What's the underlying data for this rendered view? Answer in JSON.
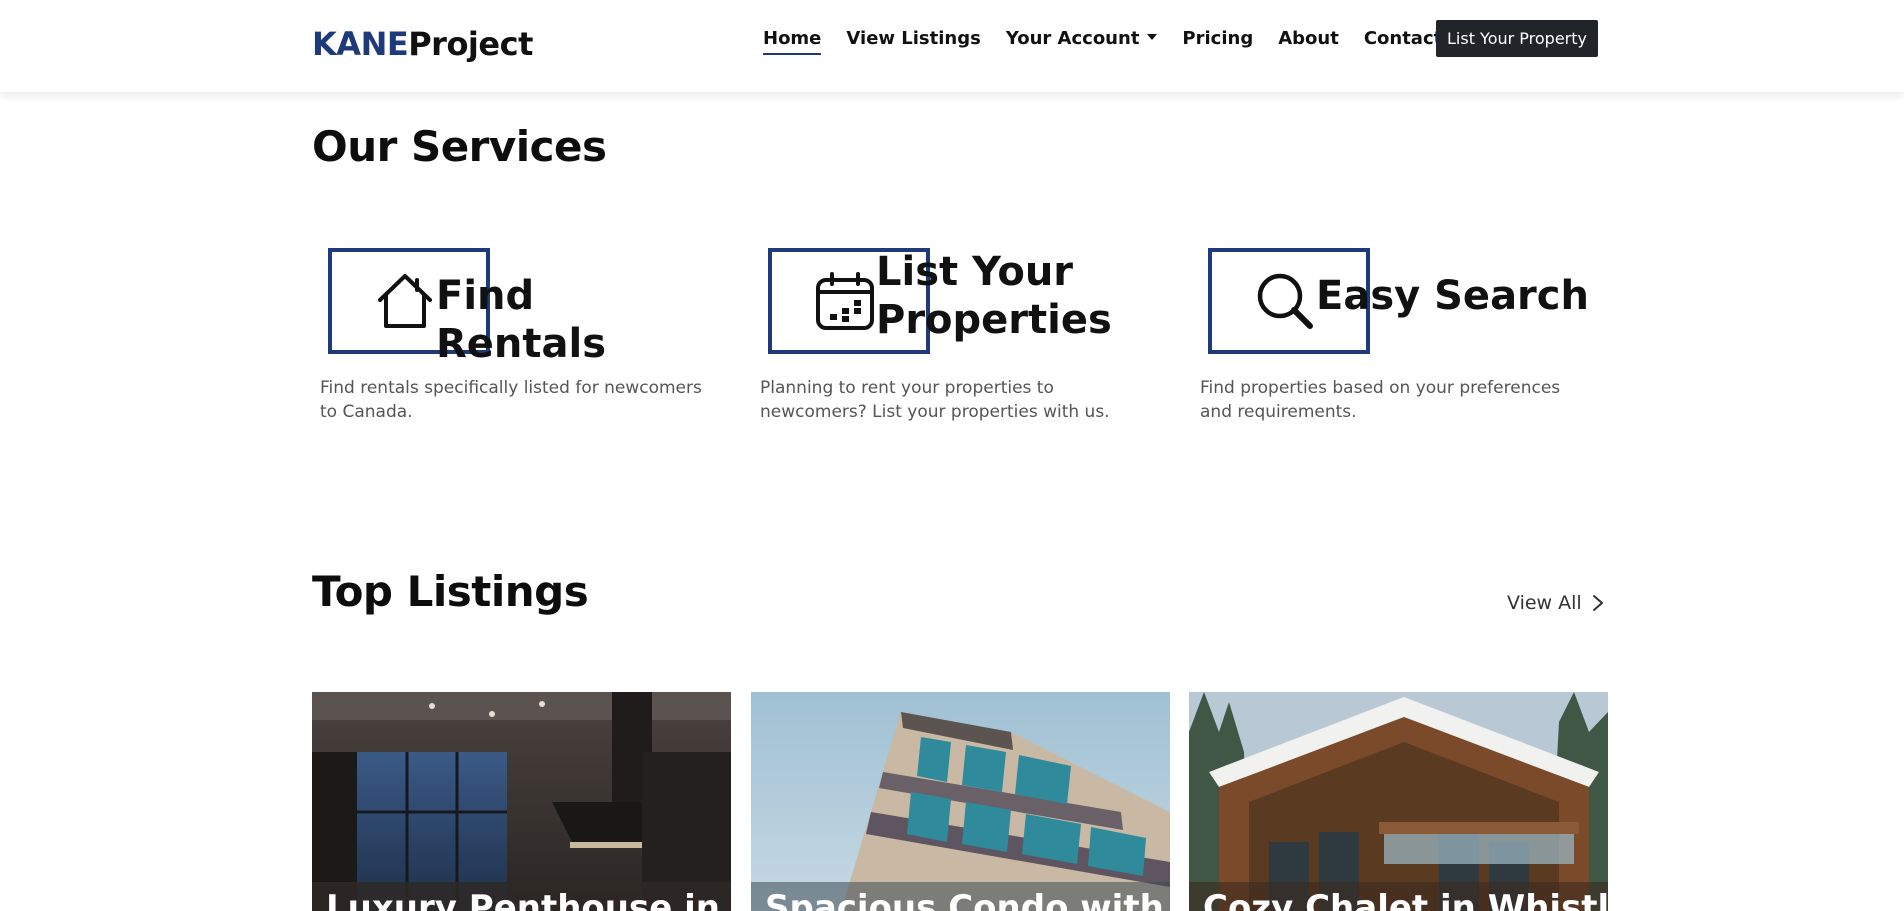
{
  "header": {
    "logo_part1": "KANE",
    "logo_part2": "Project",
    "nav": [
      "Home",
      "View Listings",
      "Your Account",
      "Pricing",
      "About",
      "Contact"
    ],
    "cta": "List Your Property"
  },
  "services": {
    "title": "Our Services",
    "items": [
      {
        "title": "Find Rentals",
        "desc": "Find rentals specifically listed for newcomers to Canada.",
        "icon": "house-icon"
      },
      {
        "title": "List Your Properties",
        "desc": "Planning to rent your properties to newcomers? List your properties with us.",
        "icon": "calendar-icon"
      },
      {
        "title": "Easy Search",
        "desc": "Find properties based on your preferences and requirements.",
        "icon": "search-icon"
      }
    ]
  },
  "listings": {
    "title": "Top Listings",
    "view_all": "View All",
    "items": [
      {
        "title": "Luxury Penthouse in"
      },
      {
        "title": "Spacious Condo with"
      },
      {
        "title": "Cozy Chalet in Whistler"
      }
    ]
  },
  "colors": {
    "brand": "#1f3a7a",
    "cta_bg": "#212529"
  }
}
